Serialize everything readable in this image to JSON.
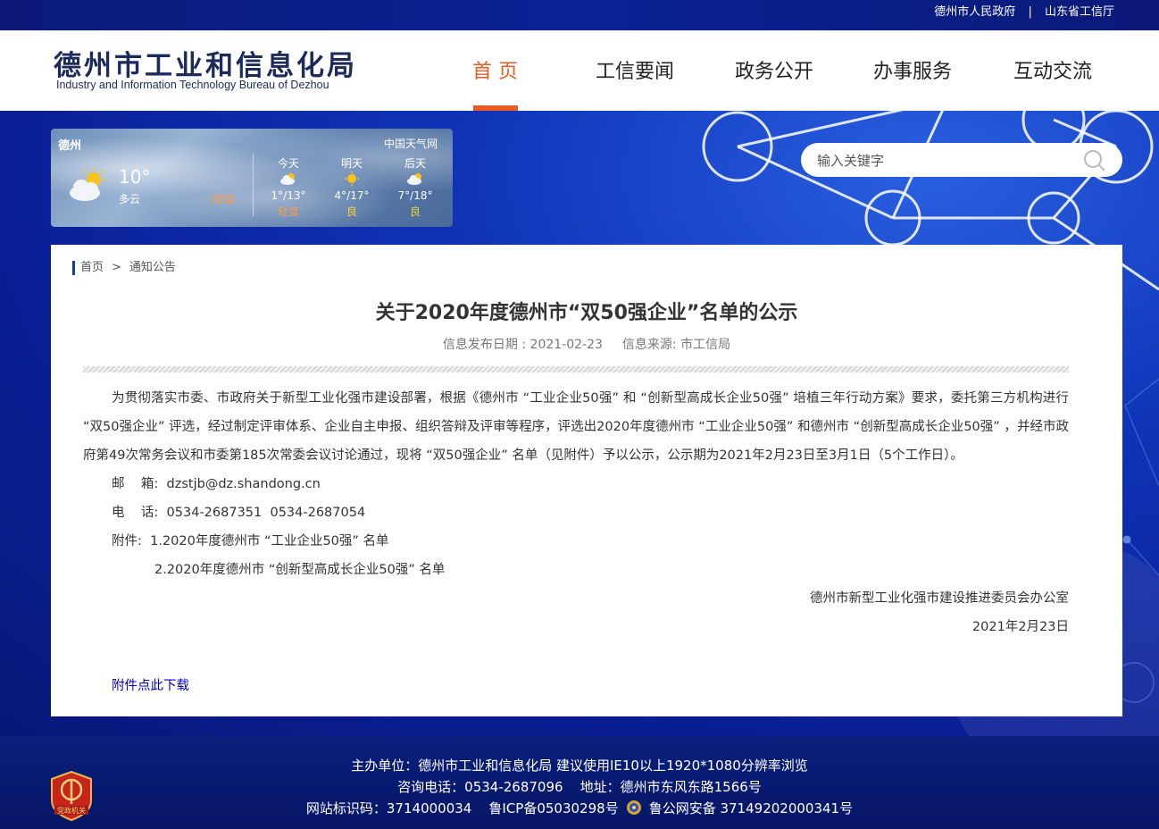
{
  "topbar": {
    "link1": "德州市人民政府",
    "separator": "|",
    "link2": "山东省工信厅"
  },
  "header": {
    "logo_cn": "德州市工业和信息化局",
    "logo_en": "Industry and Information Technology Bureau of Dezhou"
  },
  "nav": {
    "items": [
      {
        "label": "首 页"
      },
      {
        "label": "工信要闻"
      },
      {
        "label": "政务公开"
      },
      {
        "label": "办事服务"
      },
      {
        "label": "互动交流"
      }
    ],
    "active_color": "#e85b25"
  },
  "weather": {
    "city": "德州",
    "temp": "10°",
    "desc": "多云",
    "aqi": "轻度",
    "source": "中国天气网",
    "days": [
      {
        "label": "今天",
        "range": "1°/13°",
        "quality": "轻度"
      },
      {
        "label": "明天",
        "range": "4°/17°",
        "quality": "良"
      },
      {
        "label": "后天",
        "range": "7°/18°",
        "quality": "良"
      }
    ]
  },
  "search": {
    "placeholder": "输入关键字"
  },
  "breadcrumb": {
    "home": "首页",
    "sep": ">",
    "current": "通知公告"
  },
  "article": {
    "title": "关于2020年度德州市“双50强企业”名单的公示",
    "date_label": "信息发布日期 : 2021-02-23",
    "source_label": "信息来源: 市工信局",
    "paragraph": "为贯彻落实市委、市政府关于新型工业化强市建设部署，根据《德州市 “工业企业50强” 和 “创新型高成长企业50强” 培植三年行动方案》要求，委托第三方机构进行 “双50强企业” 评选，经过制定评审体系、企业自主申报、组织答辩及评审等程序，评选出2020年度德州市 “工业企业50强” 和德州市 “创新型高成长企业50强” ，并经市政府第49次常务会议和市委第185次常委会议讨论通过，现将 “双50强企业” 名单（见附件）予以公示，公示期为2021年2月23日至3月1日（5个工作日）。",
    "email_line": "邮    箱:  dzstjb@dz.shandong.cn",
    "phone_line": "电    话:  0534-2687351  0534-2687054",
    "attach1": "附件:  1.2020年度德州市 “工业企业50强” 名单",
    "attach2": "2.2020年度德州市 “创新型高成长企业50强” 名单",
    "signer": "德州市新型工业化强市建设推进委员会办公室",
    "sign_date": "2021年2月23日",
    "download": "附件点此下载"
  },
  "footer": {
    "line1": "主办单位：德州市工业和信息化局 建议使用IE10以上1920*1080分辨率浏览",
    "line2": "咨询电话：0534-2687096    地址：德州市东风东路1566号",
    "line3a": "网站标识码：3714000034    鲁ICP备05030298号",
    "line3b": "鲁公网安备 37149202000341号",
    "emblem_text": "党政机关"
  }
}
